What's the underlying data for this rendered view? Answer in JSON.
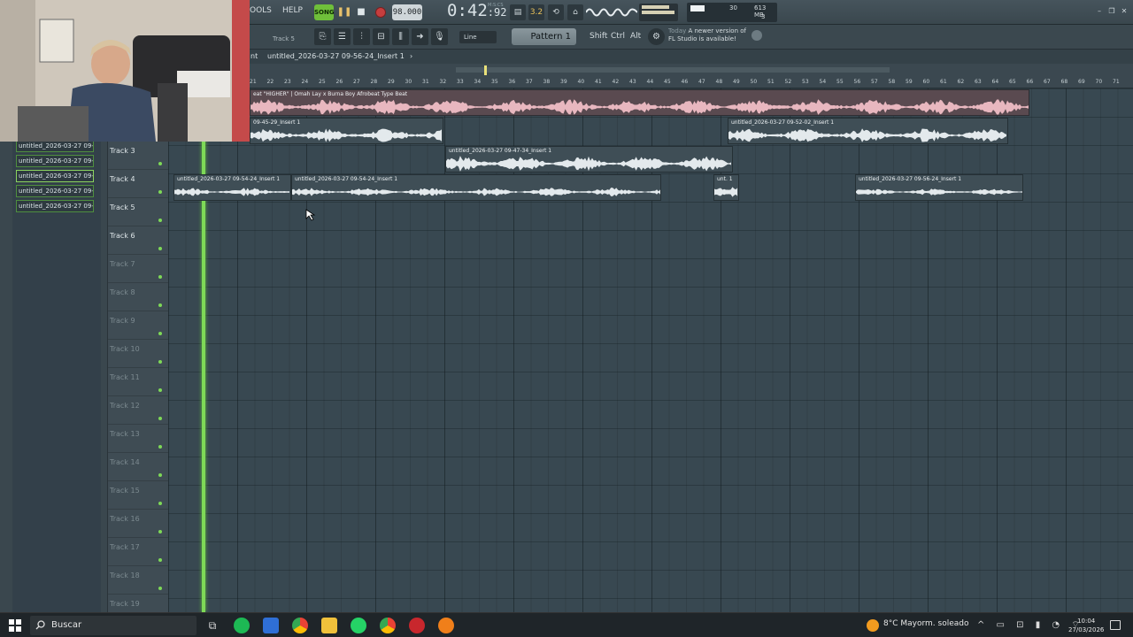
{
  "toolbar": {
    "menu_tools": "OOLS",
    "menu_help": "HELP",
    "song_mode": "SONG",
    "tempo": "98.000",
    "time_main": "0:42",
    "time_sub": ":92",
    "time_unit": "M:S:CS",
    "cpu_value": "30",
    "memory": "613 MB",
    "voices": "3"
  },
  "toolbar2": {
    "selected_track": "Track 5",
    "snap": "Line",
    "pattern": "Pattern 1",
    "key_shift": "Shift",
    "key_ctrl": "Ctrl",
    "key_alt": "Alt",
    "news_date": "Today",
    "news_line1": "A newer version of",
    "news_line2": "FL Studio is available!"
  },
  "playlist": {
    "breadcrumb_prefix": "nt",
    "breadcrumb": "untitled_2026-03-27 09-56-24_Insert 1",
    "breadcrumb_arrow": "›"
  },
  "ruler": {
    "bars": [
      "21",
      "22",
      "23",
      "24",
      "25",
      "26",
      "27",
      "28",
      "29",
      "30",
      "31",
      "32",
      "33",
      "34",
      "35",
      "36",
      "37",
      "38",
      "39",
      "40",
      "41",
      "42",
      "43",
      "44",
      "45",
      "46",
      "47",
      "48",
      "49",
      "50",
      "51",
      "52",
      "53",
      "54",
      "55",
      "56",
      "57",
      "58",
      "59",
      "60",
      "61",
      "62",
      "63",
      "64",
      "65",
      "66",
      "67",
      "68",
      "69",
      "70",
      "71"
    ]
  },
  "clip_list": [
    "untitled_2026-03-27 09-",
    "untitled_2026-03-27 09-",
    "untitled_2026-03-27 09-",
    "untitled_2026-03-27 09-",
    "untitled_2026-03-27 09-"
  ],
  "tracks": [
    "Track 3",
    "Track 4",
    "Track 5",
    "Track 6",
    "Track 7",
    "Track 8",
    "Track 9",
    "Track 10",
    "Track 11",
    "Track 12",
    "Track 13",
    "Track 14",
    "Track 15",
    "Track 16",
    "Track 17",
    "Track 18",
    "Track 19"
  ],
  "clips": {
    "beat": "eat \"HIGHER\" | Omah Lay x Burna Boy Afrobeat Type Beat",
    "t2_a": "09-45-29_Insert 1",
    "t2_b": "untitled_2026-03-27 09-52-02_Insert 1",
    "t3": "untitled_2026-03-27 09-47-34_Insert 1",
    "t4_a": "untitled_2026-03-27 09-54-24_Insert 1",
    "t4_b": "untitled_2026-03-27 09-54-24_Insert 1",
    "t4_c": "unt. 1",
    "t4_d": "untitled_2026-03-27 09-56-24_Insert 1"
  },
  "taskbar": {
    "search_placeholder": "Buscar",
    "weather": "8°C  Mayorm. soleado",
    "time": "10:04",
    "date": "27/03/2026"
  },
  "colors": {
    "accent_green": "#7ed957",
    "song_green": "#6fbf3a",
    "record_red": "#c53e3e",
    "clip_pink": "#e8b7bf",
    "grid_bg": "#384851"
  }
}
